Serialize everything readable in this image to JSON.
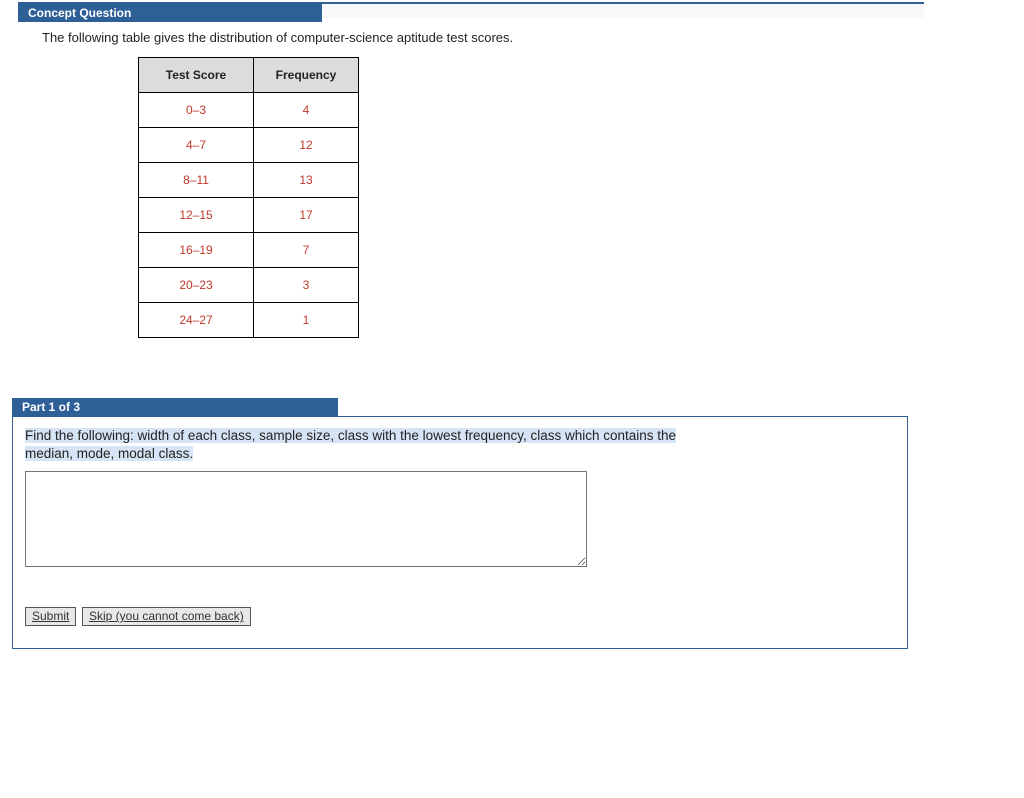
{
  "concept_header": "Concept Question",
  "intro_text": "The following table gives the distribution of computer-science aptitude test scores.",
  "table": {
    "columns": [
      "Test Score",
      "Frequency"
    ],
    "rows": [
      {
        "score": "0–3",
        "freq": "4"
      },
      {
        "score": "4–7",
        "freq": "12"
      },
      {
        "score": "8–11",
        "freq": "13"
      },
      {
        "score": "12–15",
        "freq": "17"
      },
      {
        "score": "16–19",
        "freq": "7"
      },
      {
        "score": "20–23",
        "freq": "3"
      },
      {
        "score": "24–27",
        "freq": "1"
      }
    ]
  },
  "part_header": "Part 1 of 3",
  "instruction_hl": "Find the following: width of each class, sample size, class with the lowest frequency, class which contains the",
  "instruction_hl2": "median, mode, modal class.",
  "answer_value": "",
  "buttons": {
    "submit": "Submit",
    "skip": "Skip (you cannot come back)"
  },
  "chart_data": {
    "type": "table",
    "title": "Distribution of computer-science aptitude test scores",
    "columns": [
      "Test Score",
      "Frequency"
    ],
    "rows": [
      [
        "0–3",
        4
      ],
      [
        "4–7",
        12
      ],
      [
        "8–11",
        13
      ],
      [
        "12–15",
        17
      ],
      [
        "16–19",
        7
      ],
      [
        "20–23",
        3
      ],
      [
        "24–27",
        1
      ]
    ]
  }
}
